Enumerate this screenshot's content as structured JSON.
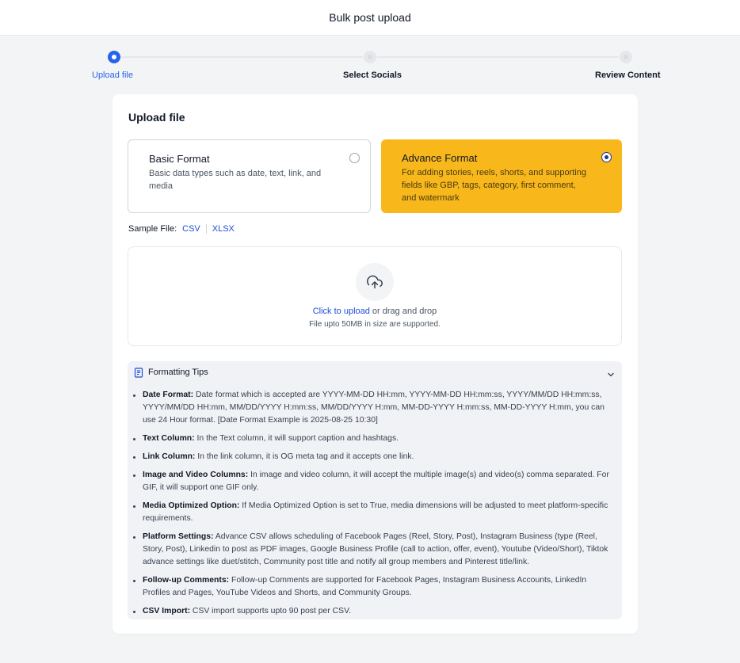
{
  "header": {
    "title": "Bulk post upload"
  },
  "stepper": {
    "steps": [
      {
        "label": "Upload file",
        "state": "active"
      },
      {
        "label": "Select Socials",
        "state": "inactive"
      },
      {
        "label": "Review Content",
        "state": "inactive"
      }
    ]
  },
  "card": {
    "title": "Upload file",
    "formats": {
      "basic": {
        "name": "Basic Format",
        "desc": "Basic data types such as date, text, link, and media",
        "selected": false
      },
      "advance": {
        "name": "Advance Format",
        "desc": "For adding stories, reels, shorts, and supporting fields like GBP, tags, category, first comment, and watermark",
        "selected": true
      }
    },
    "sample": {
      "label": "Sample File:",
      "csv": "CSV",
      "xlsx": "XLSX"
    },
    "dropzone": {
      "icon": "upload-cloud-icon",
      "link": "Click to upload",
      "rest": " or drag and drop",
      "note": "File upto 50MB in size are supported."
    },
    "tips": {
      "title": "Formatting Tips",
      "items": [
        {
          "key": "Date Format:",
          "text": " Date format which is accepted are YYYY-MM-DD HH:mm, YYYY-MM-DD HH:mm:ss, YYYY/MM/DD HH:mm:ss, YYYY/MM/DD HH:mm, MM/DD/YYYY H:mm:ss, MM/DD/YYYY H:mm, MM-DD-YYYY H:mm:ss, MM-DD-YYYY H:mm, you can use 24 Hour format. [Date Format Example is 2025-08-25 10:30]"
        },
        {
          "key": "Text Column:",
          "text": " In the Text column, it will support caption and hashtags."
        },
        {
          "key": "Link Column:",
          "text": " In the link column, it is OG meta tag and it accepts one link."
        },
        {
          "key": "Image and Video Columns:",
          "text": " In image and video column, it will accept the multiple image(s) and video(s) comma separated. For GIF, it will support one GIF only."
        },
        {
          "key": "Media Optimized Option:",
          "text": " If Media Optimized Option is set to True, media dimensions will be adjusted to meet platform-specific requirements."
        },
        {
          "key": "Platform Settings:",
          "text": " Advance CSV allows scheduling of Facebook Pages (Reel, Story, Post), Instagram Business (type (Reel, Story, Post), Linkedin to post as PDF images, Google Business Profile (call to action, offer, event), Youtube (Video/Short), Tiktok advance settings like duet/stitch, Community post title and notify all group members and Pinterest title/link."
        },
        {
          "key": "Follow-up Comments:",
          "text": " Follow-up Comments are supported for Facebook Pages, Instagram Business Accounts, LinkedIn Profiles and Pages, YouTube Videos and Shorts, and Community Groups."
        },
        {
          "key": "CSV Import:",
          "text": " CSV import supports upto 90 post per CSV."
        }
      ]
    }
  },
  "colors": {
    "accent": "#2563eb",
    "advance_bg": "#f8b81c",
    "page_bg": "#f3f4f6"
  }
}
